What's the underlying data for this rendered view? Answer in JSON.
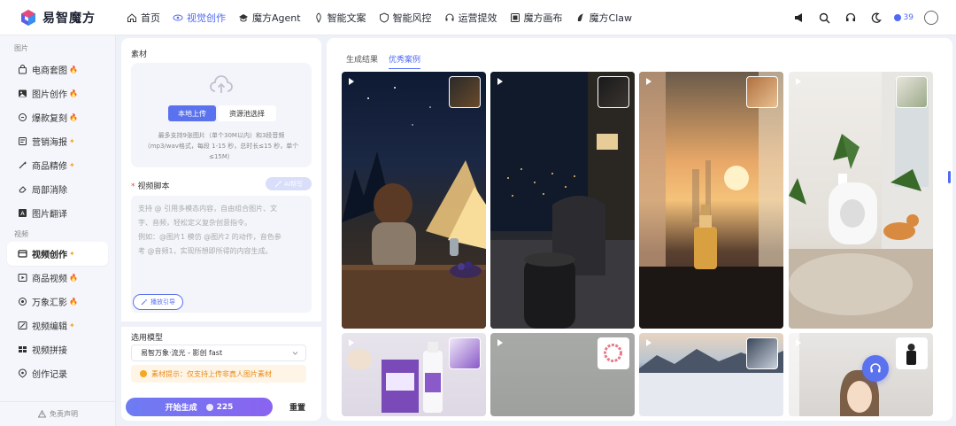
{
  "app": {
    "name": "易智魔方"
  },
  "nav": {
    "items": [
      {
        "label": "首页",
        "icon": "home-icon"
      },
      {
        "label": "视觉创作",
        "icon": "eye-icon",
        "active": true
      },
      {
        "label": "魔方Agent",
        "icon": "agent-icon"
      },
      {
        "label": "智能文案",
        "icon": "pen-icon"
      },
      {
        "label": "智能风控",
        "icon": "shield-icon"
      },
      {
        "label": "运营提效",
        "icon": "headset-icon"
      },
      {
        "label": "魔方画布",
        "icon": "canvas-icon"
      },
      {
        "label": "魔方Claw",
        "icon": "claw-icon"
      }
    ],
    "credits": "39"
  },
  "sidebar": {
    "section_image": "图片",
    "image_items": [
      {
        "label": "电商套图",
        "icon": "bag-icon",
        "hot": "fire"
      },
      {
        "label": "图片创作",
        "icon": "image-icon",
        "hot": "fire"
      },
      {
        "label": "爆款复刻",
        "icon": "copy-icon",
        "hot": "fire"
      },
      {
        "label": "营销海报",
        "icon": "poster-icon",
        "hot": "star"
      },
      {
        "label": "商品精修",
        "icon": "wand-icon",
        "hot": "star"
      },
      {
        "label": "局部消除",
        "icon": "eraser-icon",
        "hot": ""
      },
      {
        "label": "图片翻译",
        "icon": "translate-icon",
        "hot": ""
      }
    ],
    "section_video": "视频",
    "video_items": [
      {
        "label": "视频创作",
        "icon": "video-icon",
        "hot": "star",
        "active": true
      },
      {
        "label": "商品视频",
        "icon": "product-video-icon",
        "hot": "fire"
      },
      {
        "label": "万象汇影",
        "icon": "mix-icon",
        "hot": "fire"
      },
      {
        "label": "视频编辑",
        "icon": "edit-video-icon",
        "hot": "star"
      },
      {
        "label": "视频拼接",
        "icon": "splice-icon",
        "hot": ""
      },
      {
        "label": "创作记录",
        "icon": "record-icon",
        "hot": ""
      }
    ],
    "footer": "免责声明"
  },
  "panel": {
    "material_label": "素材",
    "upload_local": "本地上传",
    "resource_pick": "资源池选择",
    "upload_hint": "最多支持9张图片（单个30M以内）和3段音频（mp3/wav格式，每段 1-15 秒，总时长≤15 秒，单个≤15M）",
    "script_required": "*",
    "script_label": "视频脚本",
    "ai_write": "AI帮写",
    "script_placeholder_1": "支持 @ 引用多模态内容，自由组合图片、文",
    "script_placeholder_2": "字、音频，轻松定义复杂创意指令。",
    "script_placeholder_3": "例如：@图片1 模仿 @图片2 的动作，音色参",
    "script_placeholder_4": "考 @音频1，实现所想即所得的内容生成。",
    "cite_guide": "播放引导",
    "model_label": "选用模型",
    "model_value": "易智万象·流光 - 影创 fast",
    "tip": "素材提示：仅支持上传非真人图片素材",
    "generate": "开始生成",
    "generate_cost": "225",
    "reset": "重置"
  },
  "gallery": {
    "tabs": [
      {
        "label": "生成结果",
        "active": false
      },
      {
        "label": "优秀案例",
        "active": true
      }
    ]
  },
  "colors": {
    "accent": "#4f6bf5",
    "gradient_start": "#6d7cf2",
    "gradient_end": "#8a63f0"
  }
}
